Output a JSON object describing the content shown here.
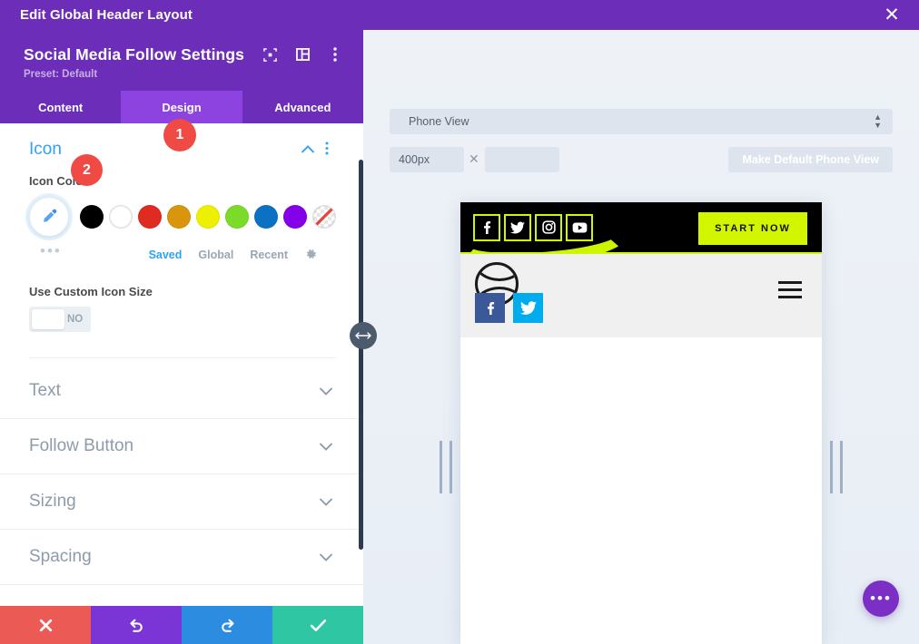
{
  "window": {
    "title": "Edit Global Header Layout",
    "close_icon": "close-icon"
  },
  "panel": {
    "module_title": "Social Media Follow Settings",
    "preset": "Preset: Default",
    "preset_caret": "▾",
    "head_icons": [
      "focus-icon",
      "layout-panel-icon",
      "more-vertical-icon"
    ],
    "tabs": [
      {
        "label": "Content",
        "active": false
      },
      {
        "label": "Design",
        "active": true
      },
      {
        "label": "Advanced",
        "active": false
      }
    ],
    "badges": [
      {
        "label": "1"
      },
      {
        "label": "2"
      }
    ],
    "icon_section": {
      "title": "Icon",
      "collapse_icon": "chevron-up-icon",
      "kebab_icon": "more-vertical-icon",
      "color_label": "Icon Color",
      "eyedropper_icon": "eyedropper-icon",
      "more_dots": "•••",
      "swatches": [
        {
          "name": "black",
          "hex": "#000000"
        },
        {
          "name": "white",
          "hex": "#ffffff"
        },
        {
          "name": "red",
          "hex": "#e02b20"
        },
        {
          "name": "orange",
          "hex": "#d9960c"
        },
        {
          "name": "yellow",
          "hex": "#edf000"
        },
        {
          "name": "green",
          "hex": "#7cdb29"
        },
        {
          "name": "blue",
          "hex": "#0c71c3"
        },
        {
          "name": "purple",
          "hex": "#8300e9"
        },
        {
          "name": "none",
          "hex": "transparent"
        }
      ],
      "palette_tabs": [
        {
          "label": "Saved",
          "active": true
        },
        {
          "label": "Global",
          "active": false
        },
        {
          "label": "Recent",
          "active": false
        }
      ],
      "gear_icon": "gear-icon",
      "custom_size_label": "Use Custom Icon Size",
      "toggle_value": "NO"
    },
    "sections": [
      {
        "label": "Text",
        "chevron": "chevron-down-icon"
      },
      {
        "label": "Follow Button",
        "chevron": "chevron-down-icon"
      },
      {
        "label": "Sizing",
        "chevron": "chevron-down-icon"
      },
      {
        "label": "Spacing",
        "chevron": "chevron-down-icon"
      }
    ],
    "actions": [
      {
        "name": "cancel",
        "icon": "close-icon",
        "color": "#ec5a55"
      },
      {
        "name": "undo",
        "icon": "undo-icon",
        "color": "#7b35d6"
      },
      {
        "name": "redo",
        "icon": "redo-icon",
        "color": "#2c8ce0"
      },
      {
        "name": "save",
        "icon": "check-icon",
        "color": "#2fc6a4"
      }
    ]
  },
  "preview": {
    "viewport_select": "Phone View",
    "width_value": "400px",
    "height_value": "",
    "multiply_symbol": "✕",
    "make_default_label": "Make Default Phone View",
    "resize_handle_icon": "resize-horizontal-icon",
    "fab_icon": "more-horizontal-icon",
    "site": {
      "header_bg": "#000000",
      "accent": "#d2f500",
      "social_icons": [
        "facebook-icon",
        "twitter-icon",
        "instagram-icon",
        "youtube-icon"
      ],
      "cta_label": "START NOW",
      "logo_icon": "circle-logo-icon",
      "menu_icon": "hamburger-menu-icon",
      "sub_social": [
        {
          "name": "facebook",
          "hex": "#3b5998"
        },
        {
          "name": "twitter",
          "hex": "#00aced"
        }
      ]
    }
  }
}
